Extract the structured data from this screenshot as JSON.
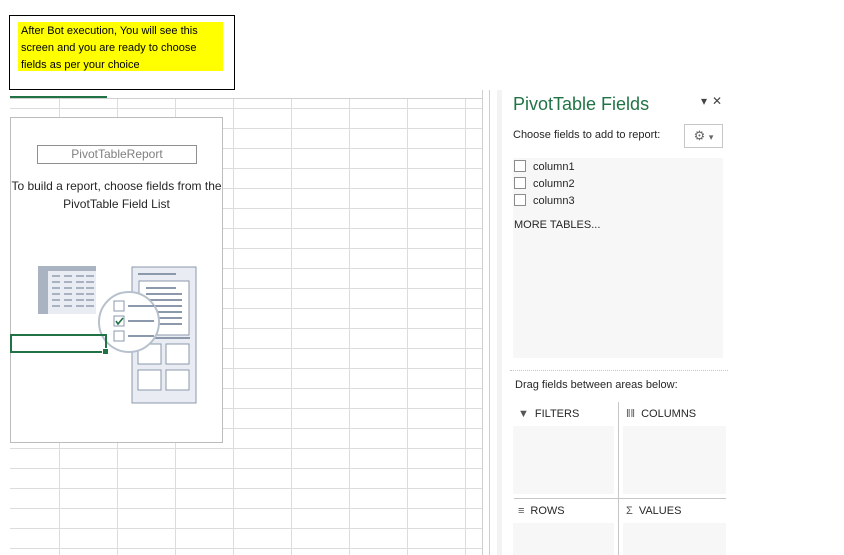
{
  "note": {
    "text": "After Bot execution, You will see this screen and you are ready to choose fields as per your choice"
  },
  "placeholder": {
    "title": "PivotTableReport",
    "description": "To build a report, choose fields from the PivotTable Field List"
  },
  "pane": {
    "title": "PivotTable Fields",
    "dropdown_icon": "chevron-down-icon",
    "close_icon": "close-icon",
    "choose_label": "Choose fields to add to report:",
    "tools_icon": "gear-icon",
    "fields": [
      {
        "label": "column1",
        "checked": false
      },
      {
        "label": "column2",
        "checked": false
      },
      {
        "label": "column3",
        "checked": false
      }
    ],
    "more_tables": "MORE TABLES...",
    "drag_label": "Drag fields between areas below:",
    "areas": {
      "filters": {
        "label": "FILTERS",
        "icon": "filter-icon"
      },
      "columns": {
        "label": "COLUMNS",
        "icon": "columns-icon"
      },
      "rows": {
        "label": "ROWS",
        "icon": "rows-icon"
      },
      "values": {
        "label": "VALUES",
        "icon": "sigma-icon"
      }
    }
  },
  "colors": {
    "accent": "#217346",
    "highlight": "#ffff00"
  }
}
